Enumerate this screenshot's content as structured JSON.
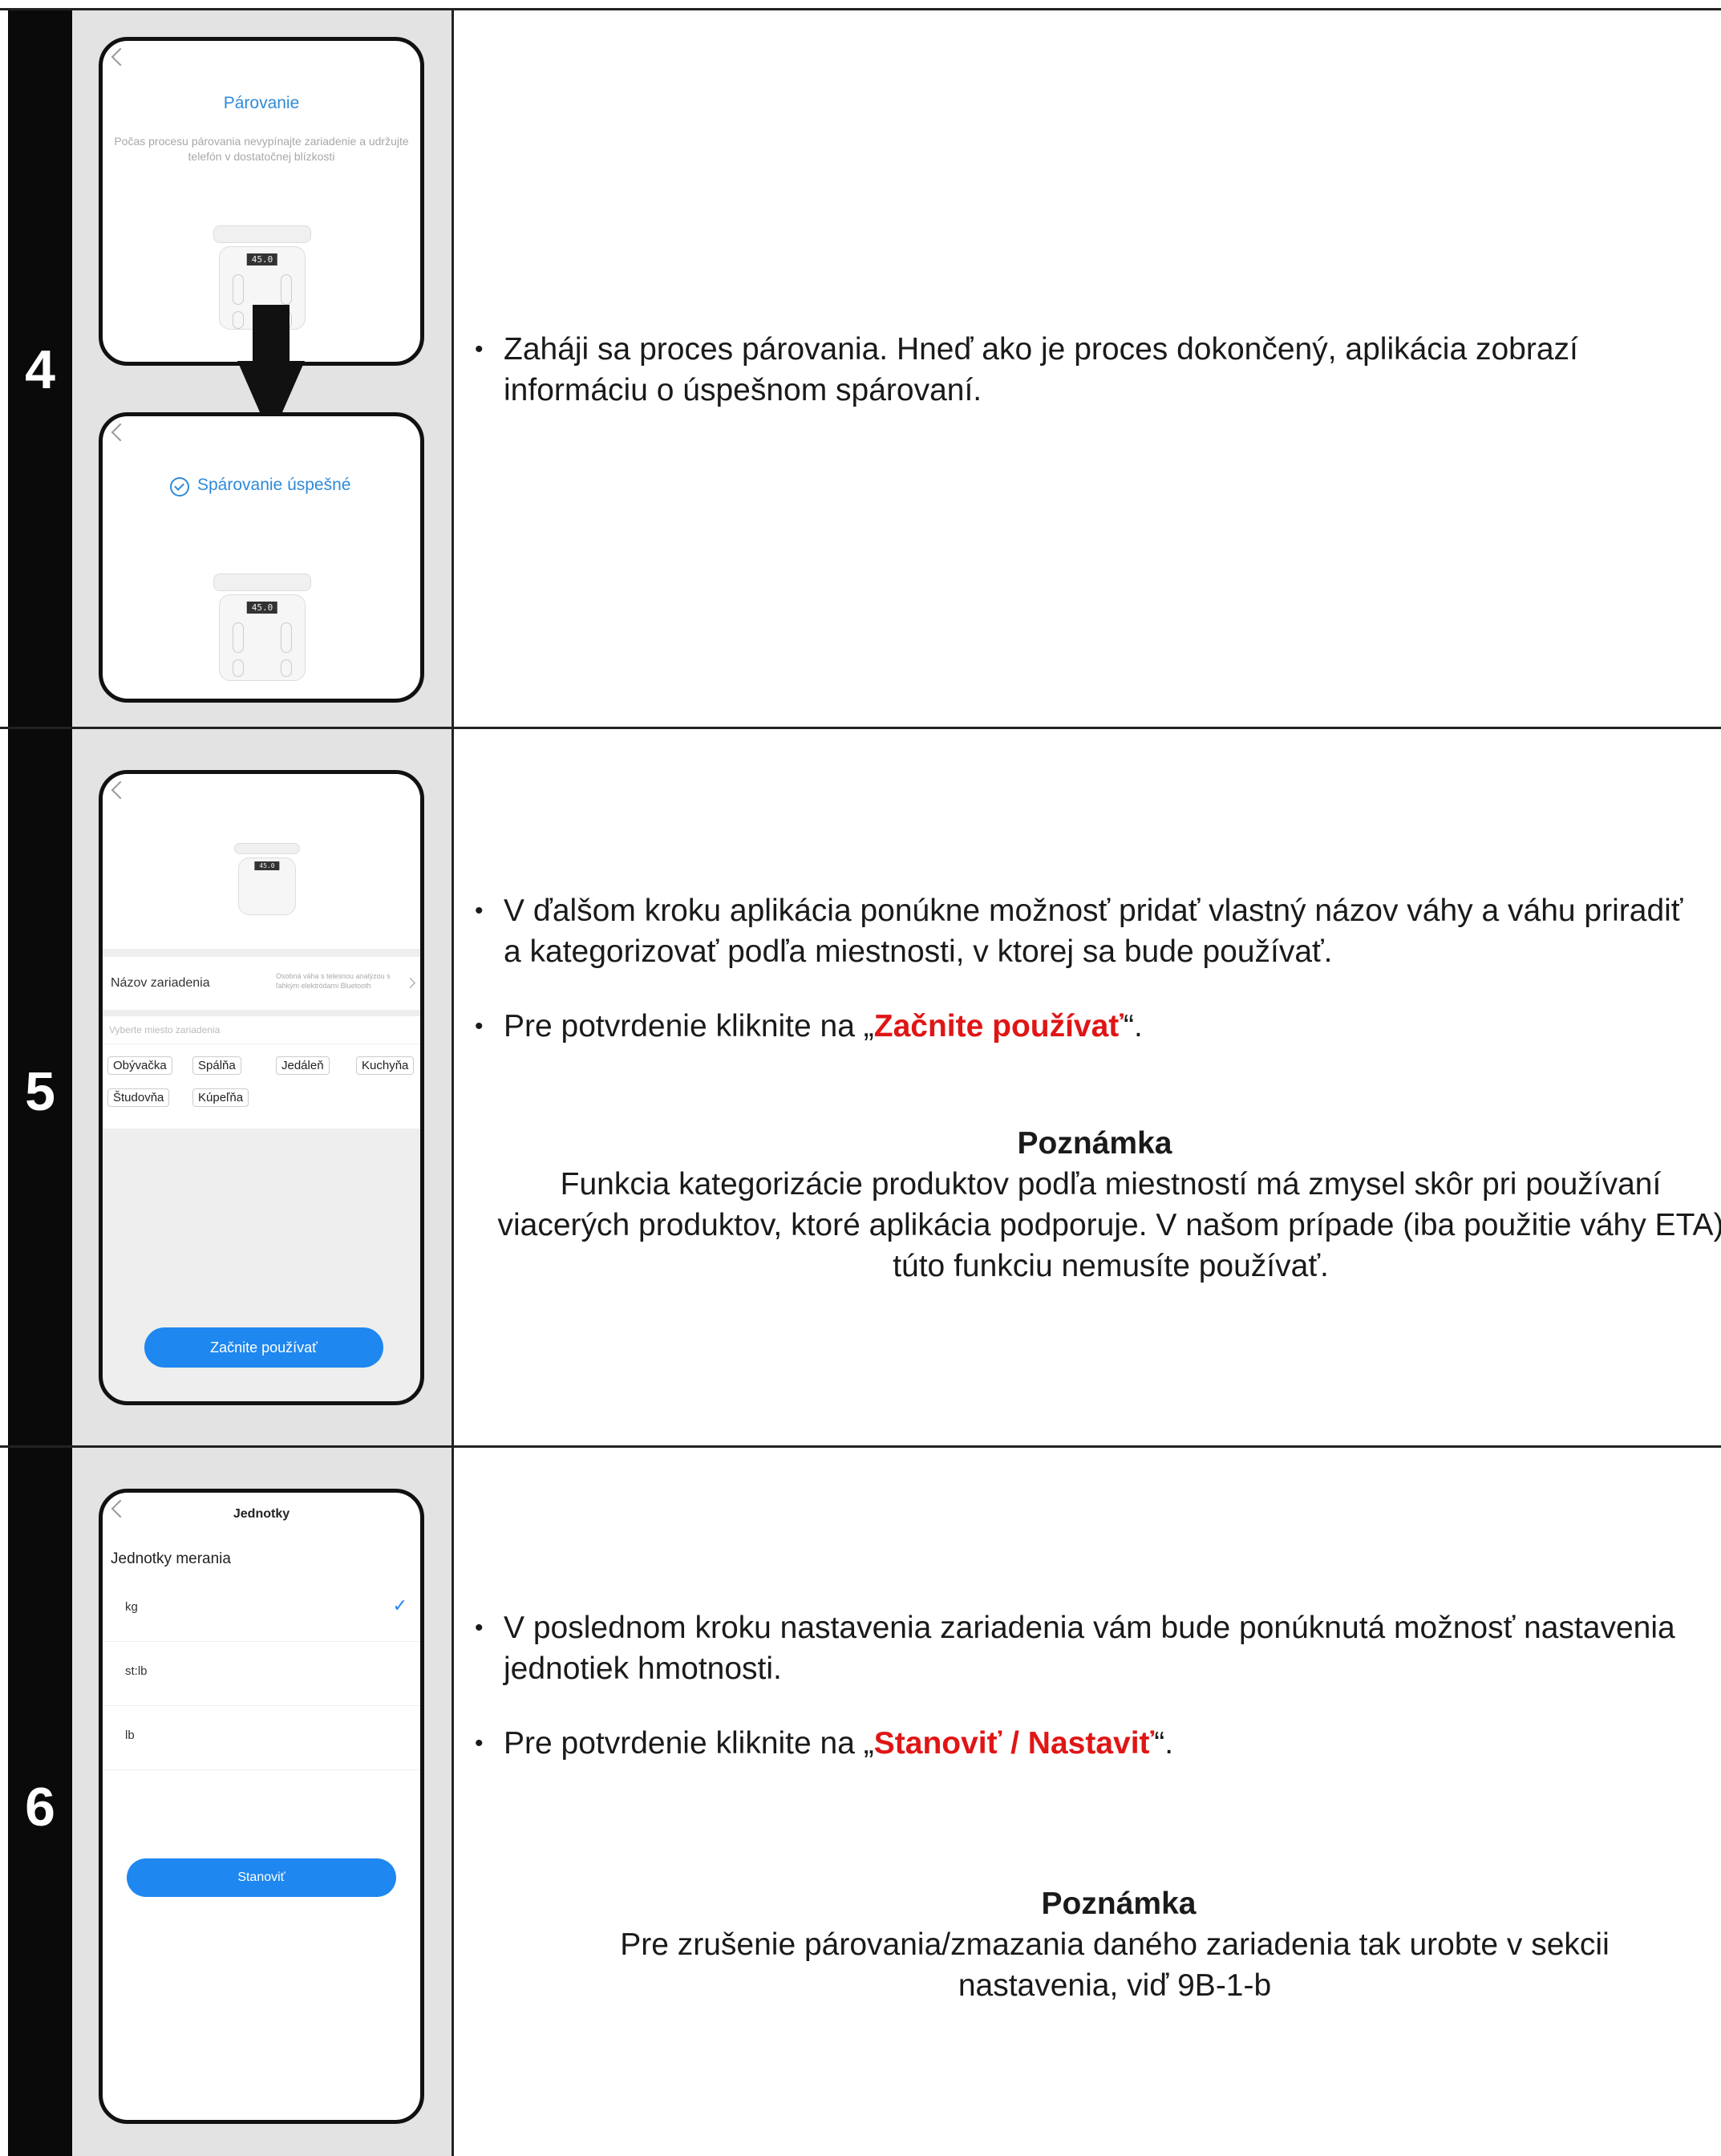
{
  "steps": [
    {
      "number": "4",
      "phone_top": {
        "title": "Párovanie",
        "subtitle": "Počas procesu párovania nevypínajte zariadenie a udržujte telefón v dostatočnej blízkosti",
        "scale_display": "45.0"
      },
      "phone_bottom": {
        "status": "Spárovanie úspešné",
        "scale_display": "45.0"
      },
      "text": "Zaháji sa proces párovania. Hneď ako je proces dokončený, aplikácia zobrazí informáciu o úspešnom spárovaní."
    },
    {
      "number": "5",
      "phone": {
        "scale_display": "45.0",
        "device_name_label": "Názov zariadenia",
        "device_name_hint": "Osobná váha s telesnou analýzou s ľahkým elektródami Bluetooth",
        "room_prompt": "Vyberte miesto zariadenia",
        "rooms": [
          "Obývačka",
          "Spálňa",
          "Jedáleň",
          "Kuchyňa",
          "Študovňa",
          "Kúpeľňa"
        ],
        "start_button": "Začnite používať"
      },
      "bullet1": "V ďalšom kroku aplikácia ponúkne možnosť pridať vlastný názov váhy a váhu priradiť a kategorizovať podľa miestnosti, v ktorej sa bude používať.",
      "bullet2_pre": "Pre potvrdenie kliknite na „",
      "bullet2_highlight": "Začnite používať",
      "bullet2_post": "“.",
      "note_title": "Poznámka",
      "note_body": "Funkcia kategorizácie produktov podľa miestností má zmysel skôr pri používaní viacerých produktov, ktoré aplikácia podporuje. V našom prípade (iba použitie váhy ETA) túto funkciu nemusíte používať."
    },
    {
      "number": "6",
      "phone": {
        "header": "Jednotky",
        "section": "Jednotky merania",
        "units": [
          "kg",
          "st:lb",
          "lb"
        ],
        "selected_mark": "✓",
        "set_button": "Stanoviť"
      },
      "bullet1": "V poslednom kroku nastavenia zariadenia vám bude ponúknutá možnosť nastavenia jednotiek hmotnosti.",
      "bullet2_pre": "Pre potvrdenie kliknite na „",
      "bullet2_highlight": "Stanoviť / Nastaviť",
      "bullet2_post": "“.",
      "note_title": "Poznámka",
      "note_body": "Pre zrušenie párovania/zmazania daného zariadenia tak urobte v sekcii nastavenia, viď 9B-1-b"
    }
  ],
  "icons": {
    "back": "chevron-left-icon",
    "check": "check-circle-icon",
    "arrow": "down-arrow-icon"
  },
  "colors": {
    "accent_blue": "#1e87f0",
    "highlight_red": "#e01515",
    "title_blue": "#2e8ad8"
  }
}
